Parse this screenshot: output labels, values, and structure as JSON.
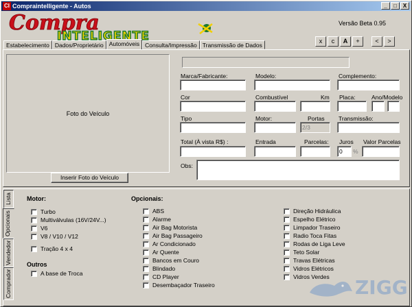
{
  "window": {
    "title": "Compraintelligente - Autos",
    "icon_text": "CI",
    "controls": [
      "_",
      "□",
      "X"
    ]
  },
  "logo": {
    "line1": "Compra",
    "line2": "INTELIGENTE"
  },
  "version": "Versão Beta 0.95",
  "nav_buttons": {
    "b1": "x",
    "b2": "c",
    "b3": "A",
    "b4": "+",
    "prev": "<",
    "next": ">"
  },
  "tabs": [
    "Estabelecimento",
    "Dados/Proprietário",
    "Automóveis",
    "Consulta/Impressão",
    "Transmissão de Dados"
  ],
  "photo": {
    "label": "Foto do Veículo",
    "button": "Inserir Foto do Veículo"
  },
  "form": {
    "marca": "Marca/Fabricante:",
    "modelo": "Modelo:",
    "complemento": "Complemento:",
    "cor": "Cor",
    "combustivel": "Combustível",
    "km": "Km",
    "placa": "Placa:",
    "ano_modelo": "Ano/Modelo",
    "tipo": "Tipo",
    "motor": "Motor:",
    "portas": "Portas",
    "portas_value": "2/3",
    "transmissao": "Transmissão:",
    "total": "Total  (À vista R$) :",
    "entrada": "Entrada",
    "parcelas": "Parcelas:",
    "juros": "Juros",
    "juros_value": "0",
    "juros_unit": "%",
    "valor_parcelas": "Valor Parcelas",
    "obs": "Obs:"
  },
  "side_tabs": [
    "Lista",
    "Opcionais",
    "Vendedor",
    "Comprador"
  ],
  "motor_section": {
    "title": "Motor:",
    "items": [
      "Turbo",
      "Multiválvulas (16V/24V...)",
      "V6",
      "V8 / V10 / V12"
    ],
    "extra": "Tração 4 x 4"
  },
  "outros_section": {
    "title": "Outros",
    "items": [
      "A base de Troca"
    ]
  },
  "opcionais_section": {
    "title": "Opcionais:",
    "col1": [
      "ABS",
      "Alarme",
      "Air Bag Motorista",
      "Air Bag Passageiro",
      "Ar Condicionado",
      "Ar Quente",
      "Bancos em Couro",
      "Blindado",
      "CD Player",
      "Desembaçador Traseiro"
    ],
    "col2": [
      "Direção Hidráulica",
      "Espelho Elétrico",
      "Limpador Traseiro",
      "Radio Toca Fitas",
      "Rodas de Liga Leve",
      "Teto Solar",
      "Travas Elétricas",
      "Vidros Elétricos",
      "Vidros Verdes"
    ]
  },
  "watermark": "ZIGG",
  "colors": {
    "face": "#d4d0c8",
    "title_start": "#0a246a",
    "title_end": "#a6caf0",
    "logo_red": "#c8101a",
    "logo_yellow": "#f2d000",
    "logo_green": "#1d7a2e",
    "watermark_blue": "#7a9cc8"
  }
}
